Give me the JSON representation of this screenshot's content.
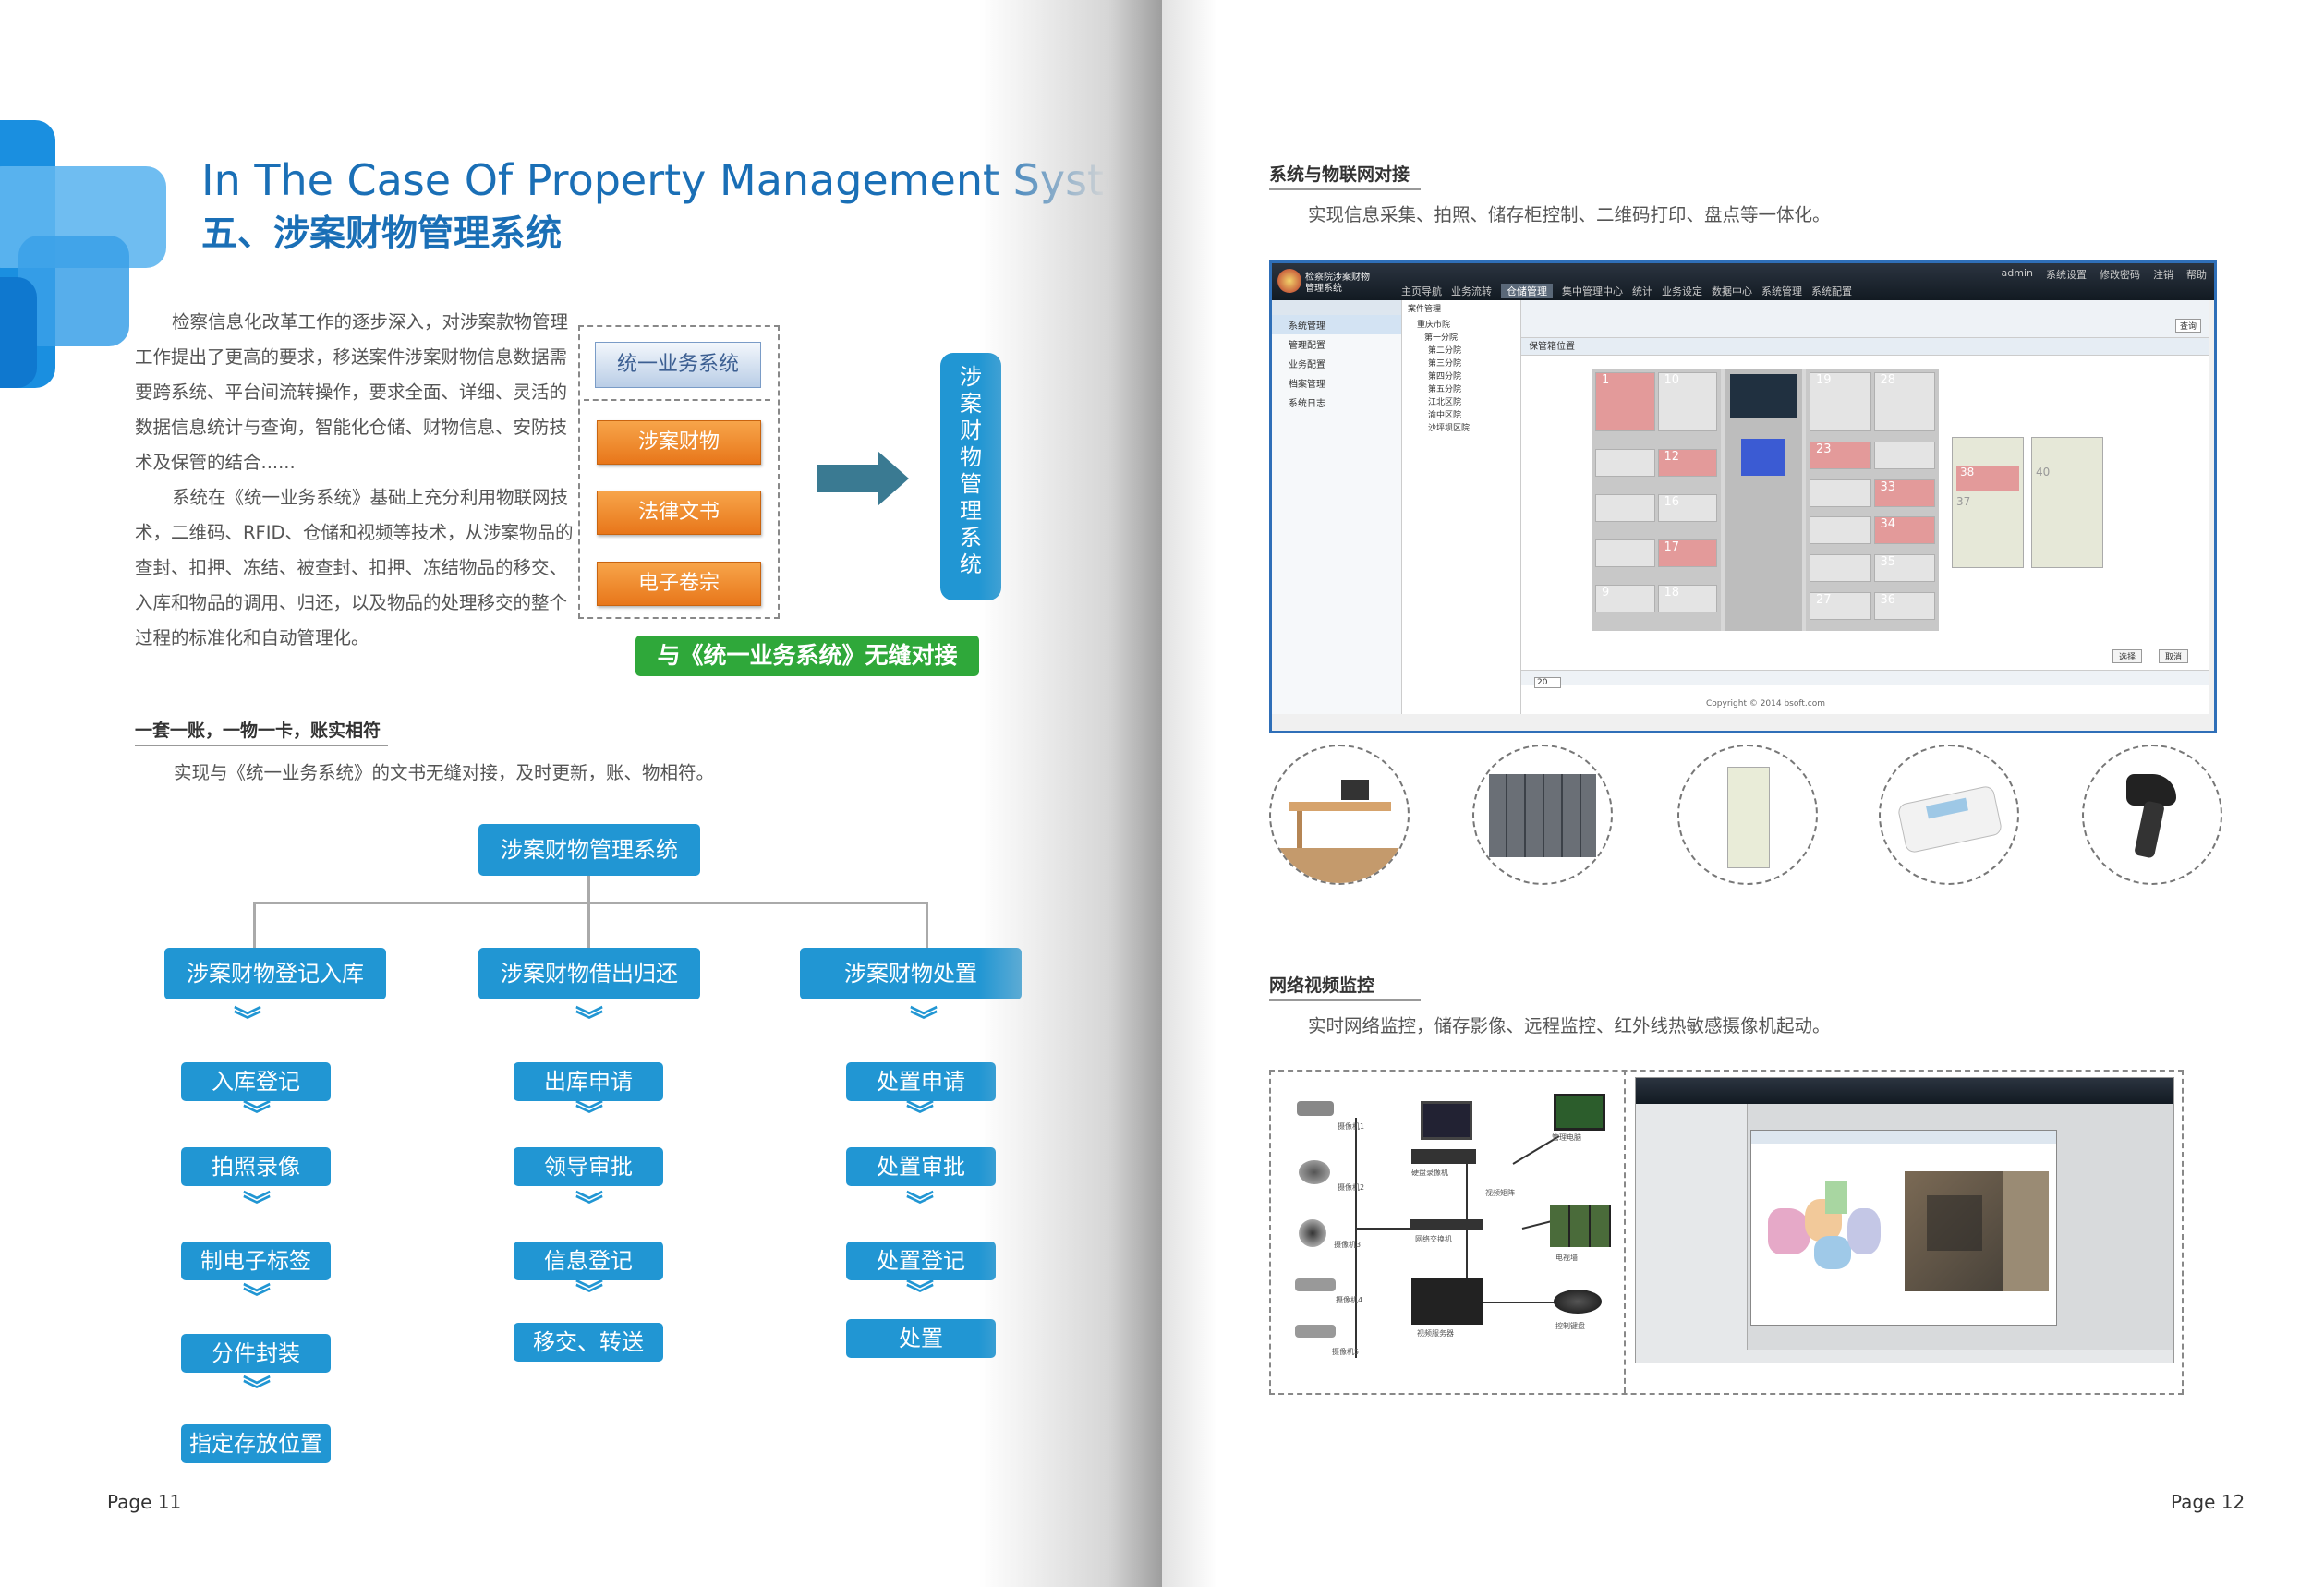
{
  "left": {
    "title_en": "In The Case Of Property Management System",
    "title_cn": "五、涉案财物管理系统",
    "intro_lines": [
      "检察信息化改革工作的逐步深入，对涉案款物管理",
      "工作提出了更高的要求，移送案件涉案财物信息数据需",
      "要跨系统、平台间流转操作，要求全面、详细、灵活的",
      "数据信息统计与查询，智能化仓储、财物信息、安防技",
      "术及保管的结合......",
      "系统在《统一业务系统》基础上充分利用物联网技",
      "术，二维码、RFID、仓储和视频等技术，从涉案物品的",
      "查封、扣押、冻结、被查封、扣押、冻结物品的移交、",
      "入库和物品的调用、归还，以及物品的处理移交的整个",
      "过程的标准化和自动管理化。"
    ],
    "diagram": {
      "top_box": "统一业务系统",
      "items": [
        "涉案财物",
        "法律文书",
        "电子卷宗"
      ],
      "target": "涉案财物管理系统",
      "green_label": "与《统一业务系统》无缝对接"
    },
    "section1_heading": "一套一账，一物一卡，账实相符",
    "section1_desc": "实现与《统一业务系统》的文书无缝对接，及时更新，账、物相符。",
    "flow": {
      "root": "涉案财物管理系统",
      "columns": [
        {
          "head": "涉案财物登记入库",
          "steps": [
            "入库登记",
            "拍照录像",
            "制电子标签",
            "分件封装",
            "指定存放位置"
          ]
        },
        {
          "head": "涉案财物借出归还",
          "steps": [
            "出库申请",
            "领导审批",
            "信息登记",
            "移交、转送"
          ]
        },
        {
          "head": "涉案财物处置",
          "steps": [
            "处置申请",
            "处置审批",
            "处置登记",
            "处置"
          ]
        }
      ]
    },
    "page": "Page  11"
  },
  "right": {
    "section2_heading": "系统与物联网对接",
    "section2_desc": "实现信息采集、拍照、储存柜控制、二维码打印、盘点等一体化。",
    "app": {
      "logo_text": "检察院涉案财物管理系统",
      "top_links": [
        "admin",
        "系统设置",
        "修改密码",
        "注销",
        "帮助"
      ],
      "tabs": [
        "主页导航",
        "业务流转",
        "仓储管理",
        "集中管理中心",
        "统计",
        "业务设定",
        "数据中心",
        "系统管理",
        "系统配置"
      ],
      "sidebar": [
        "系统管理",
        "管理配置",
        "业务配置",
        "档案管理",
        "系统日志"
      ],
      "tree_root": "案件管理",
      "tree_items": [
        "重庆市院",
        "第一分院",
        "第二分院",
        "第三分院",
        "第四分院",
        "第五分院",
        "江北区院",
        "渝中区院",
        "沙坪坝区院"
      ],
      "panel_title": "保管箱位置",
      "search_label": "查询",
      "locker_left": [
        "1",
        "10",
        "12",
        "16",
        "17",
        "9",
        "18"
      ],
      "locker_right": [
        "19",
        "28",
        "23",
        "33",
        "34",
        "35",
        "27",
        "36"
      ],
      "cabinet_nums": [
        "37",
        "38",
        "40"
      ],
      "btn_select": "选择",
      "btn_cancel": "取消",
      "pager": "20",
      "copyright": "Copyright © 2014 bsoft.com"
    },
    "devices": [
      "desk-computer",
      "locker-wall",
      "file-cabinet",
      "card-reader",
      "barcode-scanner"
    ],
    "section3_heading": "网络视频监控",
    "section3_desc": "实时网络监控，储存影像、远程监控、红外线热敏感摄像机起动。",
    "network_labels": [
      "摄像机1",
      "摄像机2",
      "摄像机3",
      "摄像机4",
      "摄像机5",
      "硬盘录像机",
      "视频矩阵",
      "网络交换机",
      "管理电脑",
      "电视墙",
      "视频服务器",
      "控制键盘"
    ],
    "page": "Page  12"
  },
  "colors": {
    "brand_blue": "#1a6fb6",
    "flow_blue": "#2196d3",
    "orange": "#ee8a2a",
    "green": "#2fa83a",
    "arrow": "#3a7a92"
  }
}
